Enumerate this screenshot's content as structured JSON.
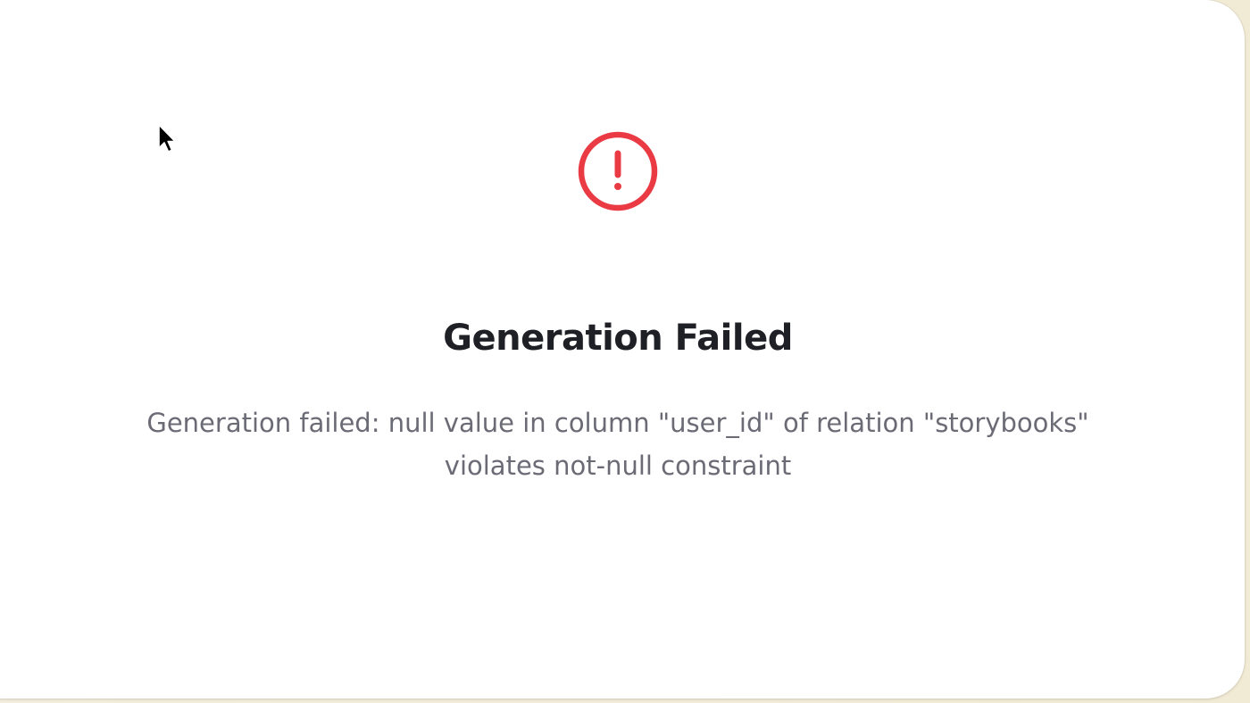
{
  "dialog": {
    "icon": "exclamation-circle-icon",
    "accent_color": "#ea3b45",
    "title": "Generation Failed",
    "message": "Generation failed: null value in column \"user_id\" of relation \"storybooks\" violates not-null constraint"
  },
  "cursor": {
    "icon": "mouse-pointer-icon"
  }
}
